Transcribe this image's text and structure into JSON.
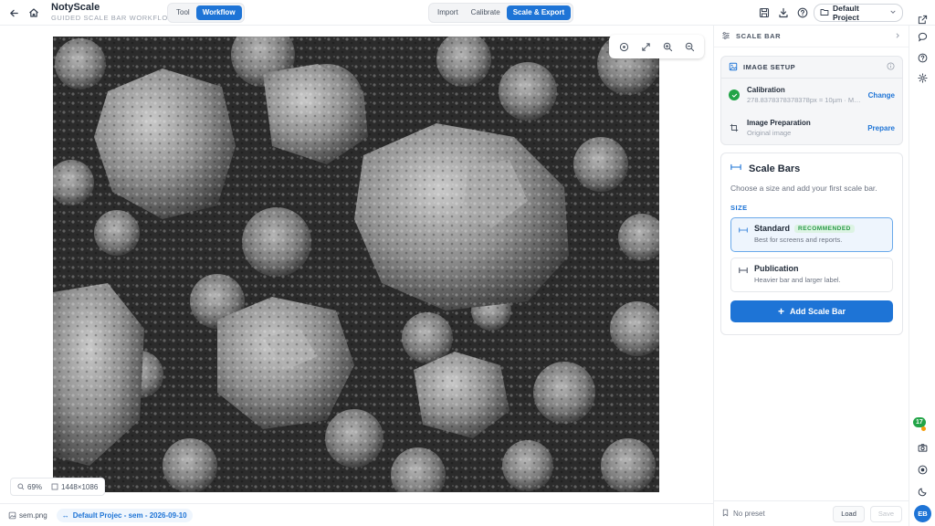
{
  "app": {
    "name": "NotyScale",
    "subtitle": "GUIDED SCALE BAR WORKFLOW"
  },
  "mode_toggle": {
    "tool_label": "Tool",
    "workflow_label": "Workflow",
    "active": "Workflow"
  },
  "steps": {
    "import_label": "Import",
    "calibrate_label": "Calibrate",
    "export_label": "Scale & Export",
    "active": "Scale & Export"
  },
  "project_select": {
    "value": "Default Project"
  },
  "canvas": {
    "zoom": "69%",
    "dimensions": "1448×1086",
    "image_alt": "SEM micrograph of particle agglomerates"
  },
  "statusbar": {
    "filename": "sem.png",
    "project_chip": "Default Projec - sem - 2026-09-10"
  },
  "panel": {
    "header": "SCALE BAR",
    "setup": {
      "title": "IMAGE SETUP",
      "calibration_label": "Calibration",
      "calibration_value": "278.8378378378378px = 10µm · Manual",
      "calibration_action": "Change",
      "prep_label": "Image Preparation",
      "prep_value": "Original image",
      "prep_action": "Prepare"
    },
    "scale_bars": {
      "title": "Scale Bars",
      "description": "Choose a size and add your first scale bar.",
      "size_label": "SIZE",
      "standard_title": "Standard",
      "standard_badge": "RECOMMENDED",
      "standard_desc": "Best for screens and reports.",
      "publication_title": "Publication",
      "publication_desc": "Heavier bar and larger label.",
      "selected": "Standard",
      "add_button": "Add Scale Bar"
    },
    "footer": {
      "preset": "No preset",
      "load": "Load",
      "save": "Save"
    }
  },
  "rail": {
    "notification_count": "17",
    "avatar_initials": "EB"
  },
  "colors": {
    "accent": "#1e74d6",
    "success": "#22a447",
    "badge_green": "#2a9a4a"
  }
}
